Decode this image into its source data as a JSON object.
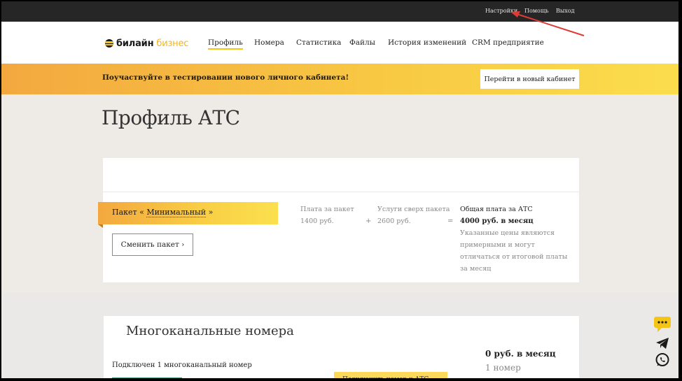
{
  "topbar": {
    "settings": "Настройки",
    "help": "Помощь",
    "logout": "Выход"
  },
  "logo": {
    "part1": "билайн",
    "part2": "бизнес"
  },
  "nav": [
    {
      "label": "Профиль",
      "active": true
    },
    {
      "label": "Номера"
    },
    {
      "label": "Статистика"
    },
    {
      "label": "Файлы"
    },
    {
      "label": "История изменений"
    },
    {
      "label": "CRM предприятие"
    }
  ],
  "promo": {
    "text": "Поучаствуйте в тестировании нового личного кабинета!",
    "button": "Перейти в новый кабинет"
  },
  "page": {
    "title": "Профиль АТС"
  },
  "package": {
    "prefix": "Пакет «",
    "name": "Минимальный",
    "suffix": "»",
    "change_button": "Сменить пакет ›",
    "fee_label": "Плата за пакет",
    "fee_value": "1400 руб.",
    "plus": "+",
    "extra_label": "Услуги сверх пакета",
    "extra_value": "2600 руб.",
    "equals": "=",
    "total_label": "Общая плата за АТС",
    "total_value": "4000 руб. в месяц",
    "note": "Указанные цены являются примерными и могут отличаться от итоговой платы за месяц"
  },
  "multichannel": {
    "title": "Многоканальные номера",
    "connected": "Подключен 1 многоканальный номер",
    "connect_button": "Подключить номер к АТС",
    "price": "0 руб. в месяц",
    "count": "1 номер"
  },
  "colors": {
    "accent": "#f4c416",
    "topbar": "#262626",
    "arrow": "#e03a35"
  }
}
